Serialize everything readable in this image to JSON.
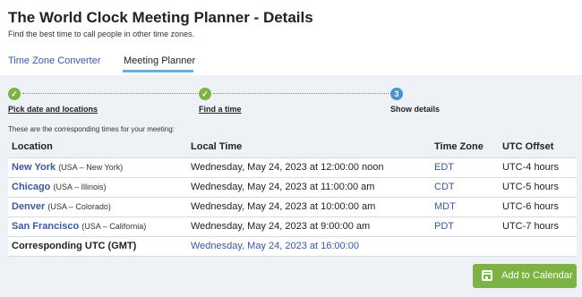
{
  "header": {
    "title": "The World Clock Meeting Planner - Details",
    "subtitle": "Find the best time to call people in other time zones."
  },
  "tabs": [
    {
      "label": "Time Zone Converter",
      "active": false
    },
    {
      "label": "Meeting Planner",
      "active": true
    }
  ],
  "steps": [
    {
      "number": "✓",
      "label": "Pick date and locations",
      "state": "done"
    },
    {
      "number": "✓",
      "label": "Find a time",
      "state": "done"
    },
    {
      "number": "3",
      "label": "Show details",
      "state": "current"
    }
  ],
  "note": "These are the corresponding times for your meeting:",
  "table": {
    "headers": [
      "Location",
      "Local Time",
      "Time Zone",
      "UTC Offset"
    ],
    "rows": [
      {
        "city": "New York",
        "region": "(USA – New York)",
        "local_time": "Wednesday, May 24, 2023 at 12:00:00 noon",
        "tz": "EDT",
        "offset": "UTC-4 hours"
      },
      {
        "city": "Chicago",
        "region": "(USA – Illinois)",
        "local_time": "Wednesday, May 24, 2023 at 11:00:00 am",
        "tz": "CDT",
        "offset": "UTC-5 hours"
      },
      {
        "city": "Denver",
        "region": "(USA – Colorado)",
        "local_time": "Wednesday, May 24, 2023 at 10:00:00 am",
        "tz": "MDT",
        "offset": "UTC-6 hours"
      },
      {
        "city": "San Francisco",
        "region": "(USA – California)",
        "local_time": "Wednesday, May 24, 2023 at 9:00:00 am",
        "tz": "PDT",
        "offset": "UTC-7 hours"
      }
    ],
    "utc_row": {
      "label": "Corresponding UTC (GMT)",
      "time": "Wednesday, May 24, 2023 at 16:00:00"
    }
  },
  "actions": {
    "add_calendar_label": "Add to Calendar",
    "add_calendar_icon": "calendar-icon",
    "accent_color": "#7cb342",
    "link_color": "#3b5998"
  }
}
